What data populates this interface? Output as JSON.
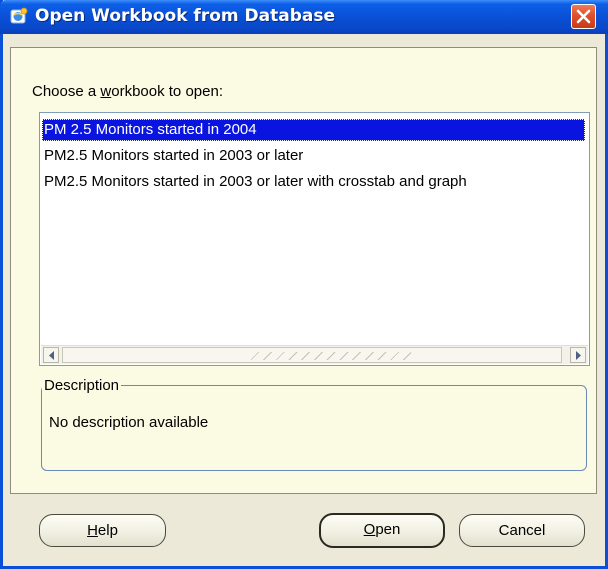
{
  "window": {
    "title": "Open Workbook from Database"
  },
  "icons": {
    "title_icon": "browser-globe-icon",
    "close_icon": "close-x-icon",
    "scroll_left_icon": "triangle-left-icon",
    "scroll_right_icon": "triangle-right-icon"
  },
  "colors": {
    "titlebar": "#0a50d6",
    "selection": "#0a14e0",
    "dialog_body": "#fbfae2",
    "close_button": "#e0502a"
  },
  "chooser": {
    "label_before": "Choose a ",
    "label_mnemonic": "w",
    "label_after": "orkbook to open:",
    "items": [
      {
        "label": "PM 2.5 Monitors started in 2004",
        "selected": true
      },
      {
        "label": "PM2.5 Monitors started in 2003 or later",
        "selected": false
      },
      {
        "label": "PM2.5 Monitors started in 2003 or later with crosstab and graph",
        "selected": false
      }
    ]
  },
  "description": {
    "legend": "Description",
    "text": "No description available"
  },
  "buttons": {
    "help": {
      "mnemonic": "H",
      "rest": "elp"
    },
    "open": {
      "mnemonic": "O",
      "rest": "pen"
    },
    "cancel": {
      "label": "Cancel"
    }
  }
}
